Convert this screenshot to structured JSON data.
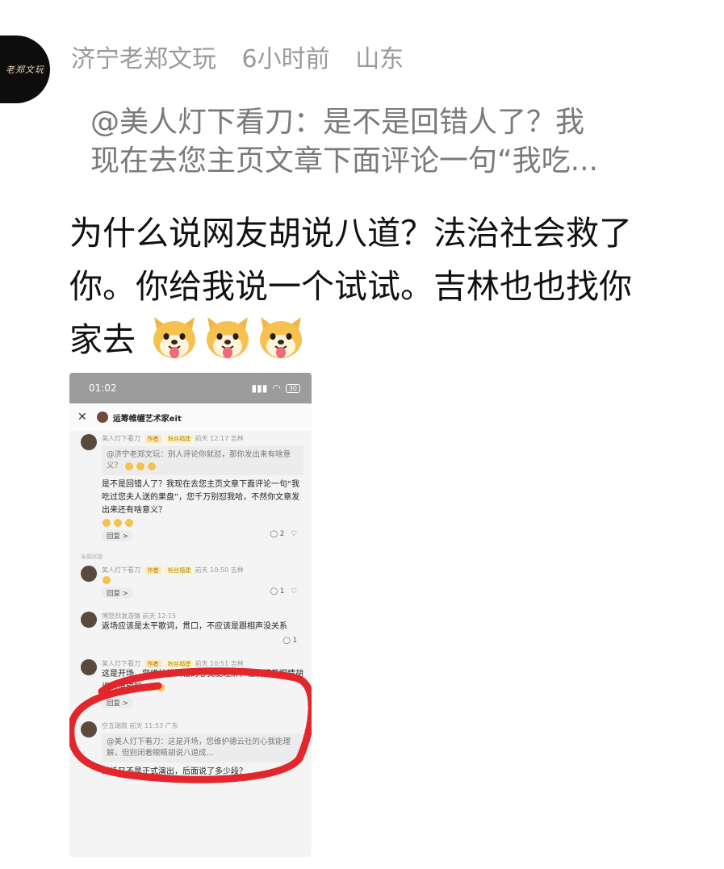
{
  "post": {
    "author": "济宁老郑文玩",
    "time": "6小时前",
    "location": "山东",
    "avatar_text": "老郑文玩",
    "quote_lines": [
      "@美人灯下看刀：是不是回错人了？我",
      "现在去您主页文章下面评论一句“我吃..."
    ],
    "body_lines": [
      "为什么说网友胡说八道？法治社会救了",
      "你。你给我说一个试试。吉林也也找你",
      "家去"
    ],
    "emoji": "dog-tongue-emoji"
  },
  "screenshot": {
    "status_time": "01:02",
    "status_battery": "30",
    "title": "运筹帷幄艺术家eit",
    "comments": [
      {
        "user": "美人灯下看刀",
        "tag_a": "作者",
        "tag_b": "粉丝福建",
        "meta": "前天 12:17  吉林",
        "quote": "@济宁老郑文玩：别人评论你就怼，那你发出来有啥意义？",
        "body": "是不是回错人了？我现在去您主页文章下面评论一句“我吃过您夫人送的果盘”，您千万别怼我哈，不然你文章发出来还有啥意义？",
        "reply": "回复 >",
        "likes": "2"
      },
      {
        "user": "美人灯下看刀",
        "tag_a": "作者",
        "tag_b": "粉丝福建",
        "meta": "前天 10:50  吉林",
        "body": "",
        "reply": "回复 >",
        "likes": "1"
      },
      {
        "user": "博怒烈发游情",
        "meta": "前天 12:15",
        "body": "返场应该是太平歌词，贯口，不应该是跟相声没关系",
        "likes": "1"
      },
      {
        "user": "美人灯下看刀",
        "tag_a": "作者",
        "tag_b": "粉丝福建",
        "meta": "前天 10:51  吉林",
        "body": "这是开场，您维护德云社的心我能理解，但别闭着眼睛胡说八道成吗",
        "reply": "回复 >"
      },
      {
        "user": "空五瑞款",
        "meta": "前天 11:53  广东",
        "quote": "@美人灯下看刀：这是开场，您维护德云社的心我能理解，但别闭着眼睛胡说八道成...",
        "body": "开场又不是正式演出，后面说了多少段？"
      }
    ],
    "section_label": "全部回复",
    "highlight_color": "#e3262c"
  }
}
